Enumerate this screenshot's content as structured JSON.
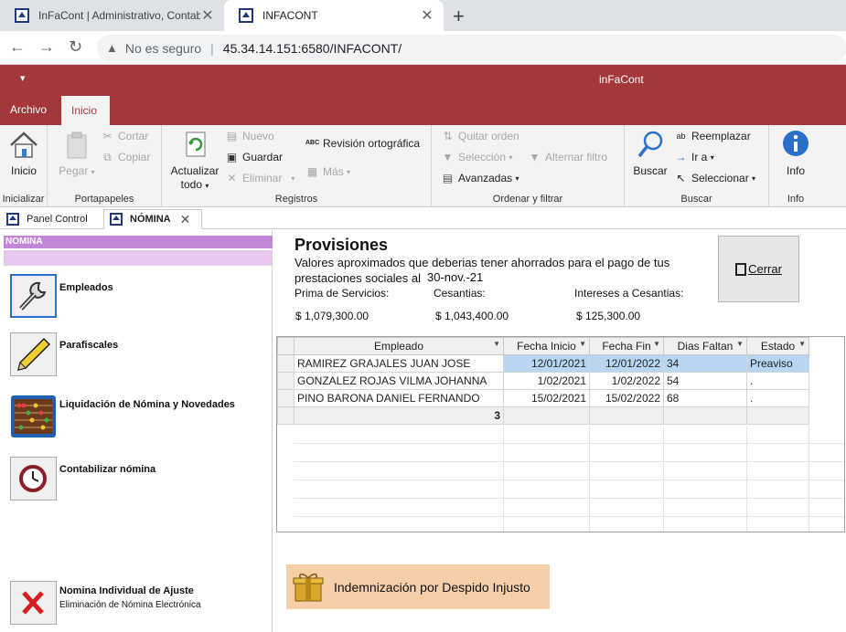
{
  "browser": {
    "tabs": [
      {
        "title": "InFaCont | Administrativo, Contab",
        "active": false
      },
      {
        "title": "INFACONT",
        "active": true
      }
    ],
    "new_tab": "+",
    "security_label": "No es seguro",
    "url": "45.34.14.151:6580/INFACONT/"
  },
  "app": {
    "name": "inFaCont",
    "qat": "▾",
    "menus": [
      "Archivo",
      "Inicio"
    ],
    "active_menu": "Inicio"
  },
  "ribbon": {
    "groups": {
      "inicializar": "Inicializar",
      "portapapeles": "Portapapeles",
      "registros": "Registros",
      "ordenar": "Ordenar y filtrar",
      "buscar": "Buscar",
      "info": "Info"
    },
    "buttons": {
      "inicio": "Inicio",
      "pegar": "Pegar",
      "cortar": "Cortar",
      "copiar": "Copiar",
      "actualizar": "Actualizar",
      "todo": "todo",
      "nuevo": "Nuevo",
      "guardar": "Guardar",
      "eliminar": "Eliminar",
      "revision": "Revisión ortográfica",
      "mas": "Más",
      "quitar_orden": "Quitar orden",
      "seleccion": "Selección",
      "alternar": "Alternar filtro",
      "avanzadas": "Avanzadas",
      "buscar": "Buscar",
      "reemplazar": "Reemplazar",
      "ira": "Ir a",
      "seleccionar": "Seleccionar",
      "info": "Info"
    }
  },
  "doc_tabs": [
    {
      "label": "Panel Control",
      "active": false
    },
    {
      "label": "NÓMINA",
      "active": true
    }
  ],
  "left": {
    "header": "NOMINA",
    "items": [
      {
        "label": "Empleados",
        "sub": "",
        "icon": "wrench-icon"
      },
      {
        "label": "Parafiscales",
        "sub": "",
        "icon": "pencil-icon"
      },
      {
        "label": "Liquidación de Nómina y Novedades",
        "sub": "",
        "icon": "abacus-icon"
      },
      {
        "label": "Contabilizar nómina",
        "sub": "",
        "icon": "clock-icon"
      },
      {
        "label": "Nomina Individual de Ajuste",
        "sub": "Eliminación de Nómina Electrónica",
        "icon": "red-x-icon"
      }
    ]
  },
  "provisiones": {
    "title": "Provisiones",
    "description": "Valores aproximados que deberias tener ahorrados para el pago de tus prestaciones sociales al",
    "date": "30-nov.-21",
    "prima_label": "Prima de Servicios:",
    "prima_value": "$ 1,079,300.00",
    "cesantias_label": "Cesantias:",
    "cesantias_value": "$ 1,043,400.00",
    "intereses_label": "Intereses a Cesantias:",
    "intereses_value": "$ 125,300.00",
    "close_button": "Cerrar"
  },
  "grid": {
    "columns": [
      "Empleado",
      "Fecha Inicio",
      "Fecha Fin",
      "Dias Faltan",
      "Estado"
    ],
    "rows": [
      [
        "RAMIREZ GRAJALES JUAN JOSE",
        "12/01/2021",
        "12/01/2022",
        "34",
        "Preaviso"
      ],
      [
        "GONZALEZ ROJAS VILMA JOHANNA",
        "1/02/2021",
        "1/02/2022",
        "54",
        "."
      ],
      [
        "PINO BARONA DANIEL FERNANDO",
        "15/02/2021",
        "15/02/2022",
        "68",
        "."
      ]
    ],
    "total": "3"
  },
  "indemnizacion_button": "Indemnización por Despido Injusto"
}
